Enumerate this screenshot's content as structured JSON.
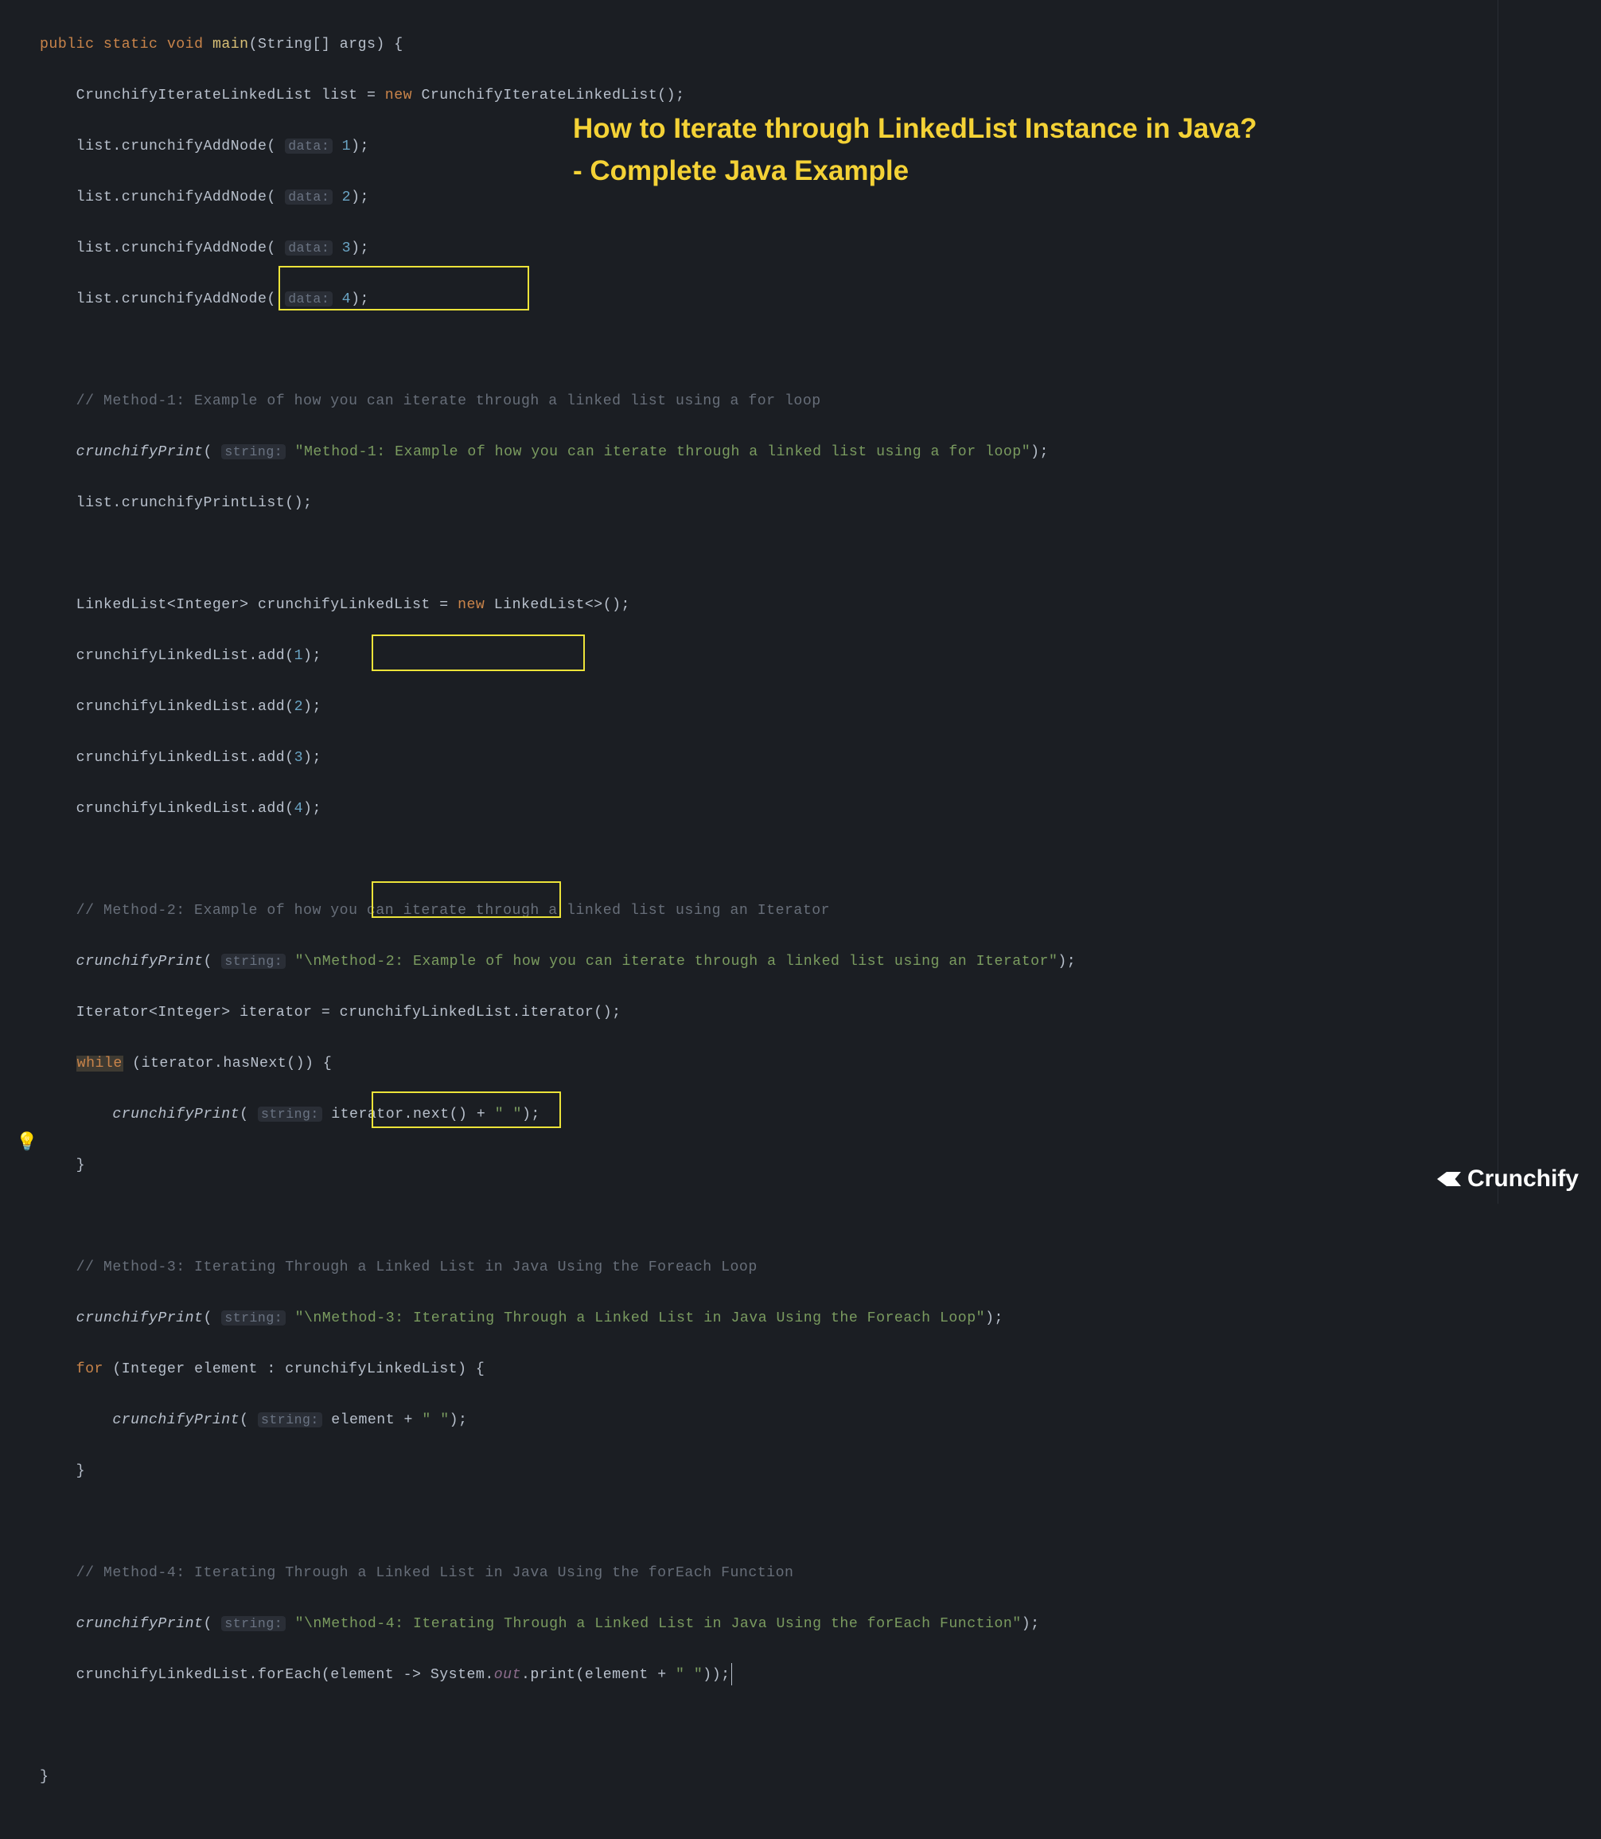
{
  "overlay": {
    "line1": "How to Iterate through LinkedList Instance in Java?",
    "line2": "- Complete Java Example"
  },
  "logo_text": "Crunchify",
  "code": {
    "kw_public": "public",
    "kw_static": "static",
    "kw_void": "void",
    "kw_new": "new",
    "kw_while": "while",
    "kw_for": "for",
    "main": "main",
    "string_arr": "String[] args",
    "type1": "CrunchifyIterateLinkedList",
    "var_list": "list",
    "ctor1": "CrunchifyIterateLinkedList()",
    "addnode": "list.crunchifyAddNode(",
    "hint_data": "data:",
    "hint_string": "string:",
    "n1": "1",
    "n2": "2",
    "n3": "3",
    "n4": "4",
    "close_pn": ");",
    "comment1": "// Method-1: Example of how you can iterate through a linked list using a for loop",
    "cprint": "crunchifyPrint",
    "cprint_open": "(",
    "str_m1": "\"Method-1: Example of how you can iterate through a linked list using a for loop\"",
    "printlist": "list.crunchifyPrintList();",
    "ll_decl_a": "LinkedList<Integer> crunchifyLinkedList = ",
    "ll_decl_b": "LinkedList<>();",
    "add_pre": "crunchifyLinkedList.add(",
    "comment2": "// Method-2: Example of how you can iterate through a linked list using an Iterator",
    "str_m2": "\"\\nMethod-2: Example of how you can iterate through a linked list using an Iterator\"",
    "iter_decl": "Iterator<Integer> iterator = crunchifyLinkedList.iterator();",
    "while_cond": "(iterator.hasNext()) {",
    "iter_next": "iterator.next() + ",
    "sp_str": "\" \"",
    "brace_close": "}",
    "comment3": "// Method-3: Iterating Through a Linked List in Java Using the Foreach Loop",
    "str_m3": "\"\\nMethod-3: Iterating Through a Linked List in Java Using the Foreach Loop\"",
    "for_hdr": "(Integer element : crunchifyLinkedList) {",
    "elem_plus": "element + ",
    "comment4": "// Method-4: Iterating Through a Linked List in Java Using the forEach Function",
    "str_m4": "\"\\nMethod-4: Iterating Through a Linked List in Java Using the forEach Function\"",
    "foreach_a": "crunchifyLinkedList.forEach(element -> System.",
    "foreach_out": "out",
    "foreach_b": ".print(element + ",
    "foreach_c": "));"
  }
}
